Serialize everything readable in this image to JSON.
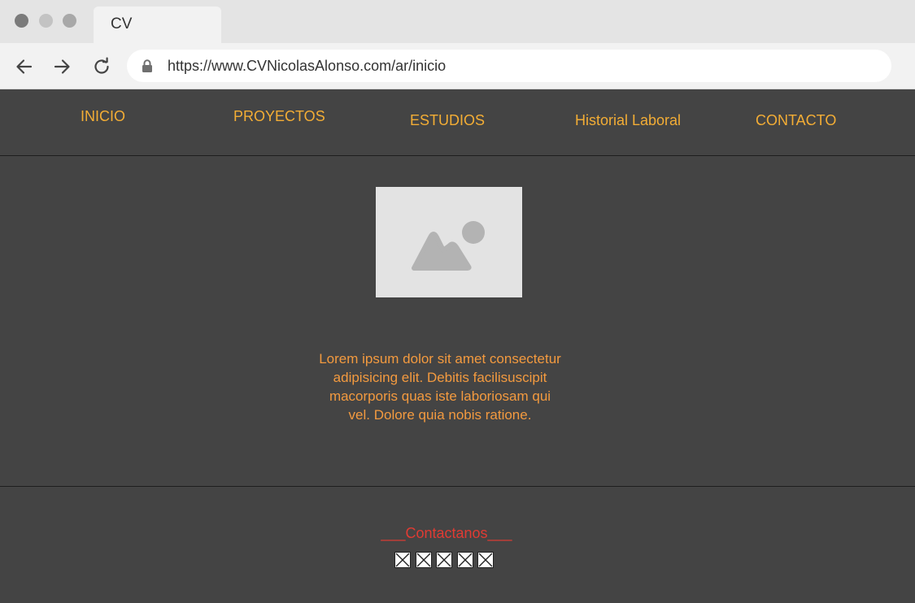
{
  "browser": {
    "tab_title": "CV",
    "url": "https://www.CVNicolasAlonso.com/ar/inicio",
    "icons": [
      "back-arrow-icon",
      "forward-arrow-icon",
      "reload-icon",
      "lock-icon"
    ]
  },
  "nav": {
    "items": [
      {
        "label": "INICIO"
      },
      {
        "label": "PROYECTOS"
      },
      {
        "label": "ESTUDIOS"
      },
      {
        "label": "Historial Laboral"
      },
      {
        "label": "CONTACTO"
      }
    ]
  },
  "main": {
    "photo_icon": "image-placeholder-icon",
    "bio": "Lorem ipsum dolor sit amet consectetur adipisicing elit. Debitis facilisuscipit macorporis quas iste laboriosam qui vel. Dolore quia nobis ratione."
  },
  "footer": {
    "contact_title": "___Contactanos___",
    "social_icons": [
      "broken-image-icon",
      "broken-image-icon",
      "broken-image-icon",
      "broken-image-icon",
      "broken-image-icon"
    ]
  },
  "colors": {
    "nav_text": "#f3ad35",
    "bio_text": "#f39a3f",
    "contact_text": "#e03b33",
    "background": "#444444"
  }
}
